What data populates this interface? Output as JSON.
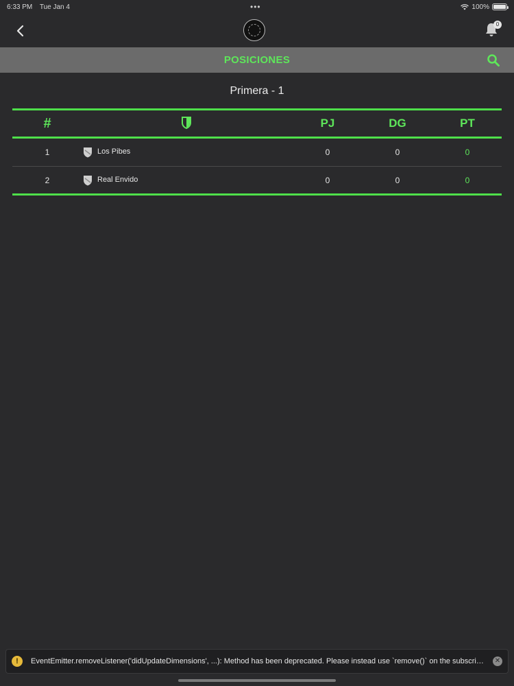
{
  "status_bar": {
    "time": "6:33 PM",
    "date": "Tue Jan 4",
    "battery": "100%"
  },
  "header": {
    "notification_count": "0"
  },
  "titlebar": {
    "title": "POSICIONES"
  },
  "standings": {
    "group_title": "Primera - 1",
    "columns": {
      "pos": "#",
      "pj": "PJ",
      "dg": "DG",
      "pt": "PT"
    },
    "rows": [
      {
        "pos": "1",
        "team": "Los Pibes",
        "pj": "0",
        "dg": "0",
        "pt": "0"
      },
      {
        "pos": "2",
        "team": "Real Envido",
        "pj": "0",
        "dg": "0",
        "pt": "0"
      }
    ]
  },
  "toast": {
    "icon": "!",
    "message": "EventEmitter.removeListener('didUpdateDimensions', ...): Method has been deprecated. Please instead use `remove()` on the subscription r..."
  },
  "colors": {
    "accent": "#5ee65a",
    "background": "#2a2a2c",
    "titlebar": "#6b6b6b"
  }
}
